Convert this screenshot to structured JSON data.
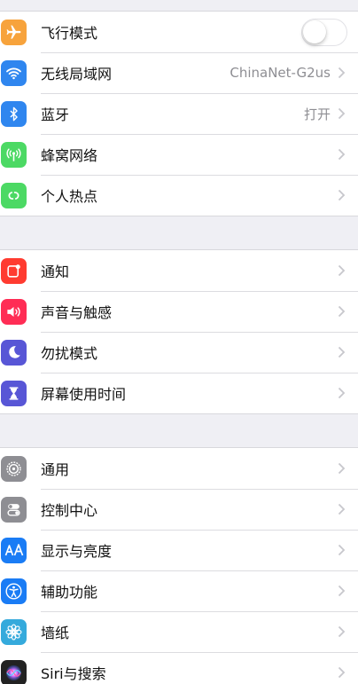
{
  "colors": {
    "airplane": "#f7a33c",
    "wifi": "#2f86ef",
    "bluetooth": "#2f86ef",
    "cellular": "#4cd964",
    "hotspot": "#4cd964",
    "notifications": "#ff3b30",
    "sounds": "#ff2d55",
    "dnd": "#5856d6",
    "screentime": "#5856d6",
    "general": "#8e8e93",
    "control": "#8e8e93",
    "display": "#1a7cf5",
    "accessibility": "#1a7cf5",
    "wallpaper": "#35aadc",
    "siri": "#222222",
    "chevron": "#c7c7cc"
  },
  "group1": [
    {
      "label": "飞行模式",
      "icon": "airplane-icon",
      "accessory": "toggle",
      "toggle_on": false
    },
    {
      "label": "无线局域网",
      "icon": "wifi-icon",
      "value": "ChinaNet-G2us"
    },
    {
      "label": "蓝牙",
      "icon": "bluetooth-icon",
      "value": "打开"
    },
    {
      "label": "蜂窝网络",
      "icon": "cellular-icon"
    },
    {
      "label": "个人热点",
      "icon": "hotspot-icon"
    }
  ],
  "group2": [
    {
      "label": "通知",
      "icon": "notifications-icon"
    },
    {
      "label": "声音与触感",
      "icon": "speaker-icon"
    },
    {
      "label": "勿扰模式",
      "icon": "moon-icon"
    },
    {
      "label": "屏幕使用时间",
      "icon": "hourglass-icon"
    }
  ],
  "group3": [
    {
      "label": "通用",
      "icon": "gear-icon"
    },
    {
      "label": "控制中心",
      "icon": "switches-icon"
    },
    {
      "label": "显示与亮度",
      "icon": "text-size-icon"
    },
    {
      "label": "辅助功能",
      "icon": "accessibility-icon"
    },
    {
      "label": "墙纸",
      "icon": "flower-icon"
    },
    {
      "label": "Siri与搜索",
      "icon": "siri-icon"
    }
  ]
}
